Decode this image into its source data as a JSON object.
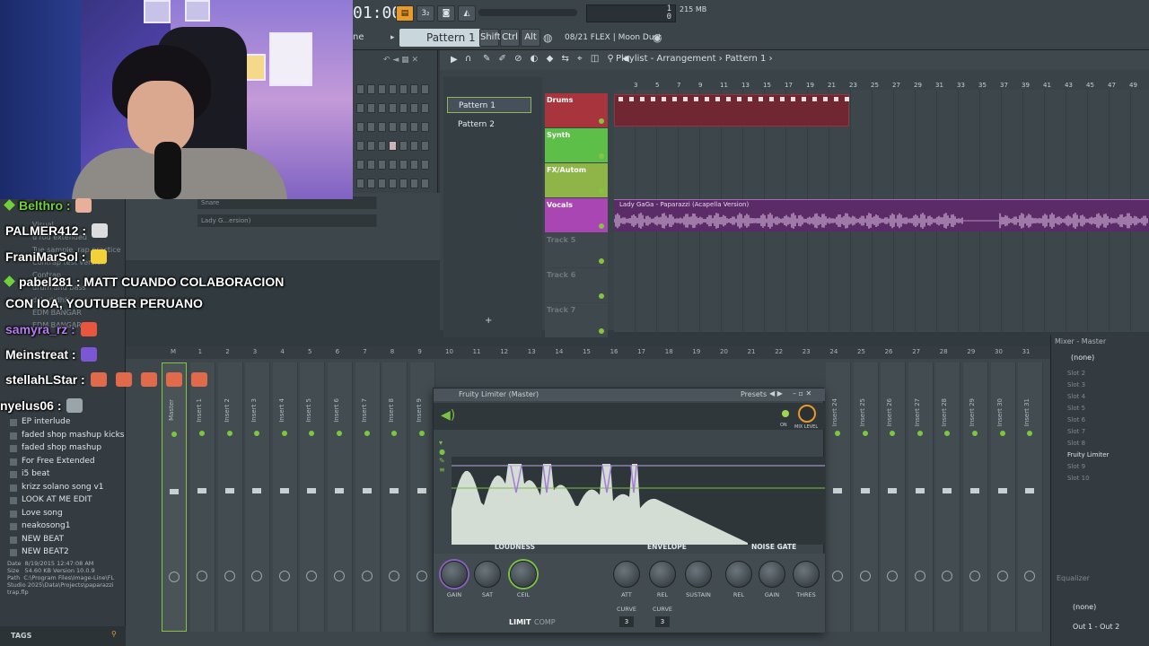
{
  "toolbar": {
    "time": "01:00",
    "pattern": "Pattern 1",
    "mode_label": "ne",
    "keys": [
      "Shift",
      "Ctrl",
      "Alt"
    ],
    "cpu_line1": "1",
    "cpu_line2": "0",
    "mem": "215 MB",
    "flex_text": "08/21  FLEX | Moon Dust"
  },
  "playlist": {
    "title": "Playlist - Arrangement",
    "pattern_crumb": "Pattern 1",
    "patterns": [
      "Pattern 1",
      "Pattern 2"
    ],
    "ruler": [
      "3",
      "5",
      "7",
      "9",
      "11",
      "13",
      "15",
      "17",
      "19",
      "21",
      "23",
      "25",
      "27",
      "29",
      "31",
      "33",
      "35",
      "37",
      "39",
      "41",
      "43",
      "45",
      "47",
      "49"
    ],
    "tracks": [
      {
        "name": "Drums",
        "color": "#a8343d"
      },
      {
        "name": "Synth",
        "color": "#5dbf47"
      },
      {
        "name": "FX/Autom",
        "color": "#8fb548"
      },
      {
        "name": "Vocals",
        "color": "#a946b4"
      },
      {
        "name": "Track 5",
        "color": "#3f484d"
      },
      {
        "name": "Track 6",
        "color": "#3f484d"
      },
      {
        "name": "Track 7",
        "color": "#3f484d"
      }
    ],
    "vocal_clip": "Lady GaGa - Paparazzi (Acapella Version)"
  },
  "rack": {
    "channels": [
      "Snare",
      "Lady G...ersion)"
    ]
  },
  "browser": {
    "items": [
      "EP interlude",
      "faded shop mashup kicks",
      "faded shop mashup",
      "For Free Extended",
      "i5 beat",
      "krizz solano song v1",
      "LOOK AT ME EDIT",
      "Love song",
      "neakosong1",
      "NEW BEAT",
      "NEW BEAT2"
    ],
    "ghost_items": [
      "Visual",
      "u rod extended",
      "Tue sample, rap practice",
      "Contrap test version",
      "Contrap",
      "drum and bass",
      "dshsdjdhfs",
      "EDM BANGAR",
      "EDM BANGAR_3"
    ],
    "info": {
      "date": "8/19/2015 12:47:08 AM",
      "size": "54.60 KB",
      "version": "Version 10.0.9",
      "path": "C:\\Program Files\\Image-Line\\FL Studio 2025\\Data\\Projects\\paparazzi trap.flp"
    },
    "tags_label": "TAGS"
  },
  "mixer": {
    "title": "Mixer - Master",
    "master_label": "Master",
    "inserts": [
      "Insert 1",
      "Insert 2",
      "Insert 3",
      "Insert 4",
      "Insert 5",
      "Insert 6",
      "Insert 7",
      "Insert 8",
      "Insert 9"
    ],
    "inserts_right": [
      "Insert 24",
      "Insert 25",
      "Insert 26",
      "Insert 27",
      "Insert 28",
      "Insert 29",
      "Insert 30",
      "Insert 31"
    ],
    "numbers": [
      "M",
      "1",
      "2",
      "3",
      "4",
      "5",
      "6",
      "7",
      "8",
      "9",
      "10",
      "11",
      "12",
      "13",
      "14",
      "15",
      "16",
      "17",
      "18",
      "19",
      "20",
      "21",
      "22",
      "23",
      "24",
      "25",
      "26",
      "27",
      "28",
      "29",
      "30",
      "31"
    ],
    "preset": "(none)",
    "slots": [
      "Slot 2",
      "Slot 3",
      "Slot 4",
      "Slot 5",
      "Slot 6",
      "Slot 7",
      "Slot 8",
      "Fruity Limiter",
      "Slot 9",
      "Slot 10"
    ],
    "active_slot": "Fruity Limiter",
    "eq_label": "Equalizer",
    "out_preset": "(none)",
    "output": "Out 1 - Out 2"
  },
  "limiter": {
    "title": "Fruity Limiter (Master)",
    "presets": "Presets",
    "on_label": "ON",
    "mix_label": "MIX LEVEL",
    "sections": [
      "LOUDNESS",
      "ENVELOPE",
      "NOISE GATE"
    ],
    "knobs": [
      "GAIN",
      "SAT",
      "CEIL",
      "ATT",
      "REL",
      "SUSTAIN",
      "REL",
      "GAIN",
      "THRES"
    ],
    "curve_label": "CURVE",
    "curve_values": [
      "3",
      "3"
    ],
    "tabs": [
      "LIMIT",
      "COMP"
    ]
  },
  "chat": [
    {
      "user": "Belthro",
      "color": "#6fd03a",
      "badge": true,
      "message": "",
      "emote": "#e8b09a"
    },
    {
      "user": "PALMER412",
      "color": "#ffffff",
      "badge": false,
      "message": "",
      "emote": "#dddddd"
    },
    {
      "user": "FraniMarSol",
      "color": "#ffffff",
      "badge": false,
      "message": "",
      "emote": "#f3d13b"
    },
    {
      "user": "pabel281",
      "color": "#ffffff",
      "badge": true,
      "message": "MATT CUANDO COLABORACION",
      "emote": ""
    },
    {
      "user": "",
      "color": "#ffffff",
      "badge": false,
      "message": "CON IOA, YOUTUBER PERUANO",
      "emote": ""
    },
    {
      "user": "samyra_rz",
      "color": "#b77cf0",
      "badge": false,
      "message": "",
      "emote": "#e85640"
    },
    {
      "user": "Meinstreat",
      "color": "#ffffff",
      "badge": false,
      "message": "",
      "emote": "#7b57d6"
    },
    {
      "user": "stellahLStar",
      "color": "#ffffff",
      "badge": false,
      "message": "",
      "emote": "#e06a4a"
    },
    {
      "user": "nyelus06",
      "color": "#ffffff",
      "badge": false,
      "message": "",
      "emote": "#9aa5aa"
    }
  ]
}
